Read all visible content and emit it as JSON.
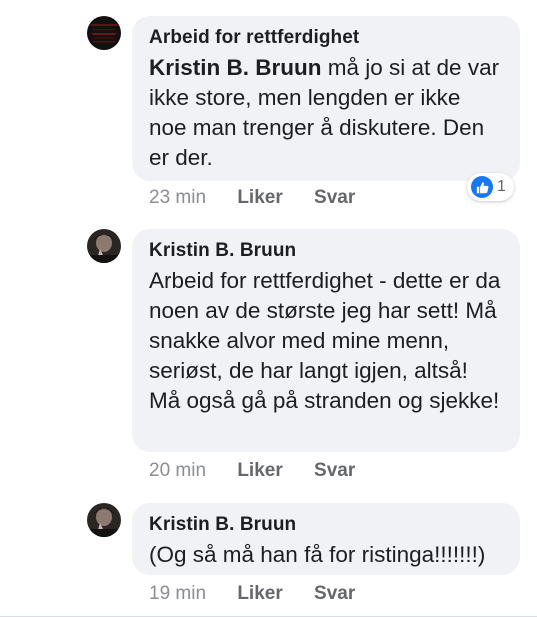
{
  "comments": [
    {
      "author": "Arbeid for rettferdighet",
      "mention": "Kristin B. Bruun",
      "text_line1": " må jo si at de",
      "text_rest": "var ikke store, men lengden er ikke noe man trenger å diskutere. Den er der.",
      "time": "23 min",
      "like_label": "Liker",
      "reply_label": "Svar",
      "reaction_count": "1",
      "reaction_icon": "like-icon",
      "avatar_icon": "dark-avatar"
    },
    {
      "author": "Kristin B. Bruun",
      "text": "Arbeid for rettferdighet - dette er da noen av de største jeg har sett! Må snakke alvor med mine menn, seriøst, de har langt igjen, altså! Må også gå på stranden og sjekke!",
      "time": "20 min",
      "like_label": "Liker",
      "reply_label": "Svar",
      "avatar_icon": "profile-photo-avatar"
    },
    {
      "author": "Kristin B. Bruun",
      "text": "(Og så må han få for ristinga!!!!!!!)",
      "time": "19 min",
      "like_label": "Liker",
      "reply_label": "Svar",
      "avatar_icon": "profile-photo-avatar"
    }
  ],
  "colors": {
    "bubble_bg": "#f0f2f5",
    "text": "#1c1e21",
    "secondary": "#65676b",
    "like_blue": "#1877f2"
  }
}
